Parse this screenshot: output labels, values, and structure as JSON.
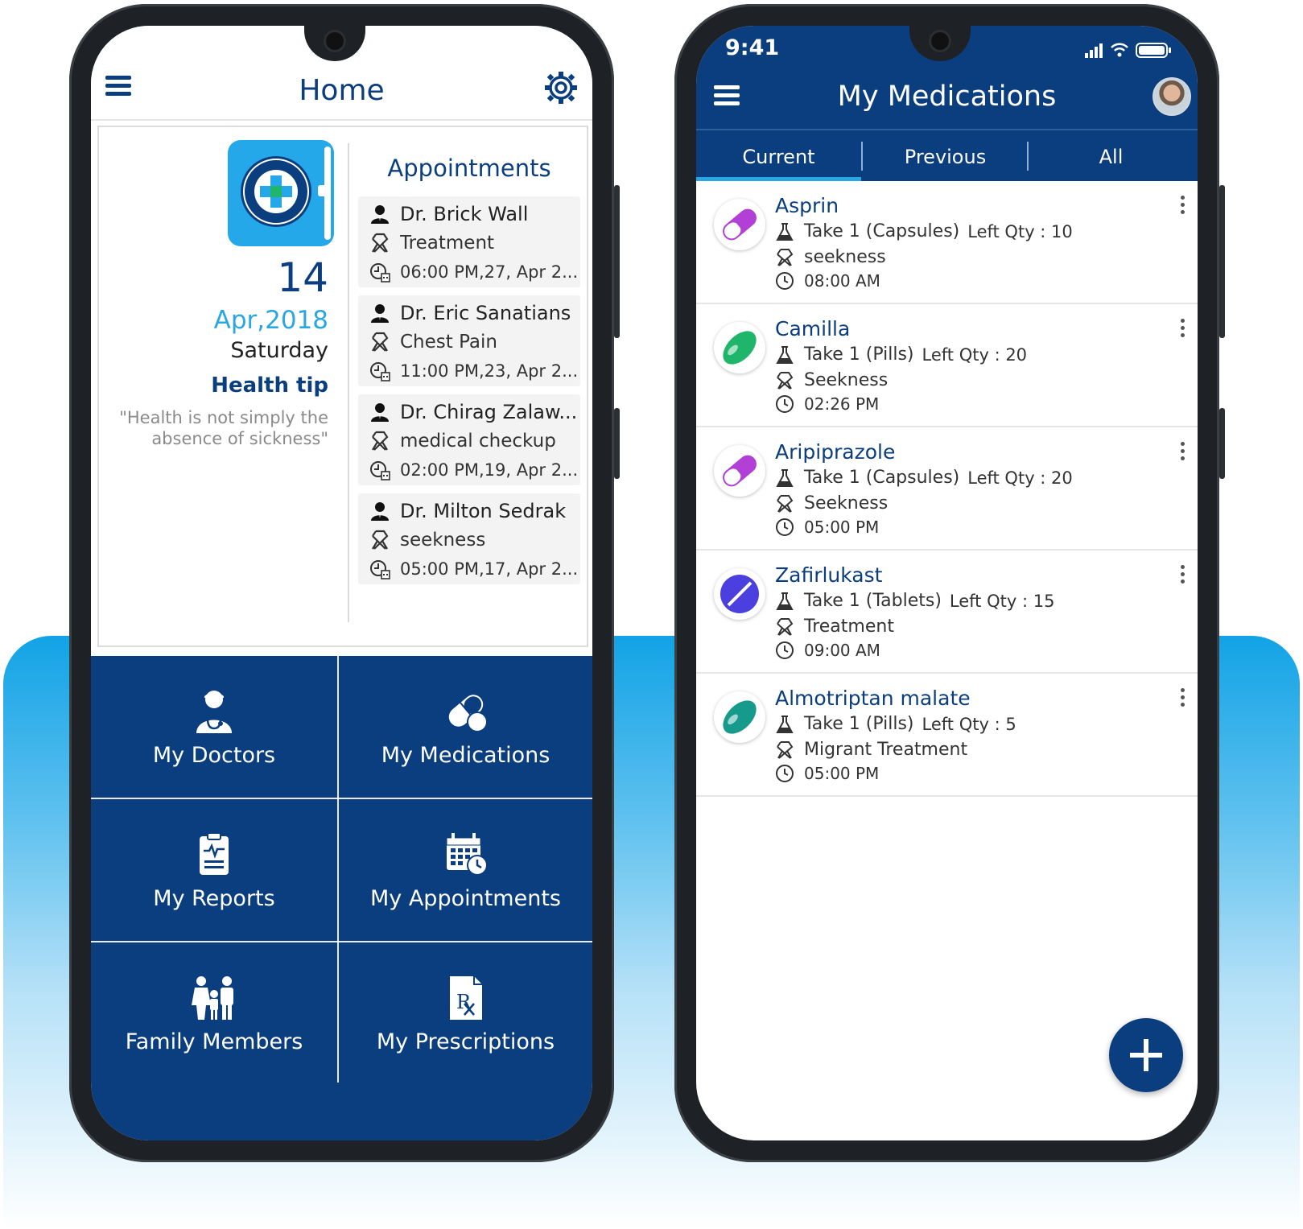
{
  "colors": {
    "brand_navy": "#0b3e7f",
    "accent_blue": "#29a7e3",
    "tile_text": "#ffffff"
  },
  "home": {
    "title": "Home",
    "menu_icon": "hamburger-icon",
    "settings_icon": "gear-icon",
    "date": {
      "day": "14",
      "month_year": "Apr,2018",
      "weekday": "Saturday"
    },
    "health_tip": {
      "title": "Health tip",
      "text": "\"Health is not simply the absence of sickness\""
    },
    "appointments": {
      "heading": "Appointments",
      "items": [
        {
          "doctor": "Dr. Brick Wall",
          "reason": "Treatment",
          "time": "06:00 PM,27, Apr 2..."
        },
        {
          "doctor": "Dr. Eric Sanatians",
          "reason": "Chest Pain",
          "time": "11:00 PM,23, Apr 2..."
        },
        {
          "doctor": "Dr. Chirag Zalaw...",
          "reason": "medical checkup",
          "time": "02:00 PM,19, Apr 2..."
        },
        {
          "doctor": "Dr. Milton Sedrak",
          "reason": "seekness",
          "time": "05:00 PM,17, Apr 2..."
        }
      ]
    },
    "tiles": [
      {
        "label": "My Doctors",
        "icon": "doctor-icon"
      },
      {
        "label": "My Medications",
        "icon": "pill-icon"
      },
      {
        "label": "My Reports",
        "icon": "clipboard-icon"
      },
      {
        "label": "My Appointments",
        "icon": "calendar-icon"
      },
      {
        "label": "Family Members",
        "icon": "family-icon"
      },
      {
        "label": "My Prescriptions",
        "icon": "prescription-icon"
      }
    ]
  },
  "meds": {
    "status_time": "9:41",
    "title": "My Medications",
    "tabs": [
      "Current",
      "Previous",
      "All"
    ],
    "active_tab": "Current",
    "items": [
      {
        "name": "Asprin",
        "dose": "Take 1 (Capsules)",
        "qty": "Left Qty : 10",
        "reason": "seekness",
        "time": "08:00 AM",
        "pill": "capsule",
        "color": "#b23fd6"
      },
      {
        "name": "Camilla",
        "dose": "Take 1 (Pills)",
        "qty": "Left Qty : 20",
        "reason": "Seekness",
        "time": "02:26 PM",
        "pill": "oval",
        "color": "#1fb56a"
      },
      {
        "name": "Aripiprazole",
        "dose": "Take 1 (Capsules)",
        "qty": "Left Qty : 20",
        "reason": "Seekness",
        "time": "05:00 PM",
        "pill": "capsule",
        "color": "#b23fd6"
      },
      {
        "name": "Zafirlukast",
        "dose": "Take 1 (Tablets)",
        "qty": "Left Qty : 15",
        "reason": "Treatment",
        "time": "09:00 AM",
        "pill": "tablet",
        "color": "#4b3fe0"
      },
      {
        "name": "Almotriptan malate",
        "dose": "Take 1 (Pills)",
        "qty": "Left Qty : 5",
        "reason": "Migrant Treatment",
        "time": "05:00 PM",
        "pill": "oval",
        "color": "#169a8c"
      }
    ],
    "fab_icon": "plus-icon"
  }
}
